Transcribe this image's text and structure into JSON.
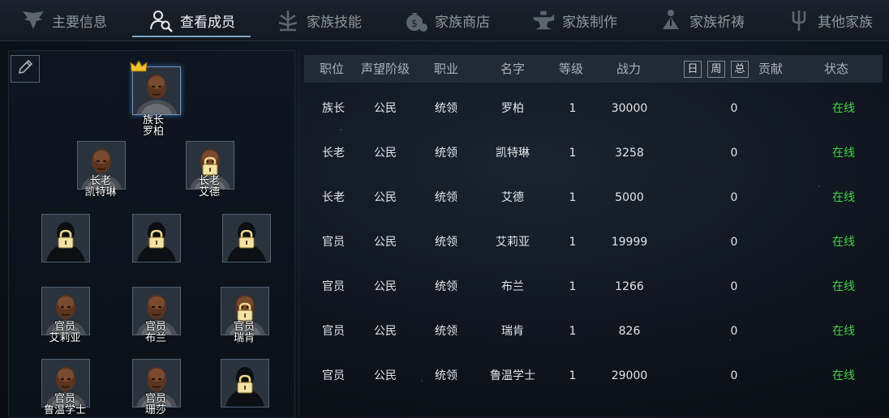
{
  "tabs": [
    {
      "label": "主要信息",
      "icon": "wings-emblem-icon"
    },
    {
      "label": "查看成员",
      "icon": "members-search-icon",
      "active": true
    },
    {
      "label": "家族技能",
      "icon": "skill-tree-icon"
    },
    {
      "label": "家族商店",
      "icon": "money-bag-icon"
    },
    {
      "label": "家族制作",
      "icon": "anvil-icon"
    },
    {
      "label": "家族祈祷",
      "icon": "prayer-icon"
    },
    {
      "label": "其他家族",
      "icon": "trident-icon"
    }
  ],
  "tree": {
    "leader": {
      "title": "族长",
      "name": "罗柏"
    },
    "elders": [
      {
        "title": "长老",
        "name": "凯特琳"
      },
      {
        "title": "长老",
        "name": "艾德"
      }
    ],
    "officers": [
      {
        "title": "官员",
        "name": "艾莉亚"
      },
      {
        "title": "官员",
        "name": "布兰"
      },
      {
        "title": "官员",
        "name": "瑞肯"
      },
      {
        "title": "官员",
        "name": "鲁温学士"
      },
      {
        "title": "官员",
        "name": "珊莎"
      }
    ]
  },
  "table": {
    "headers": {
      "position": "职位",
      "reputation": "声望阶级",
      "class": "职业",
      "name": "名字",
      "level": "等级",
      "power": "战力",
      "day": "日",
      "week": "周",
      "total": "总",
      "contribution": "贡献",
      "status": "状态"
    },
    "rows": [
      {
        "position": "族长",
        "reputation": "公民",
        "class": "统领",
        "name": "罗柏",
        "level": "1",
        "power": "30000",
        "contribution": "0",
        "status": "在线"
      },
      {
        "position": "长老",
        "reputation": "公民",
        "class": "统领",
        "name": "凯特琳",
        "level": "1",
        "power": "3258",
        "contribution": "0",
        "status": "在线"
      },
      {
        "position": "长老",
        "reputation": "公民",
        "class": "统领",
        "name": "艾德",
        "level": "1",
        "power": "5000",
        "contribution": "0",
        "status": "在线"
      },
      {
        "position": "官员",
        "reputation": "公民",
        "class": "统领",
        "name": "艾莉亚",
        "level": "1",
        "power": "19999",
        "contribution": "0",
        "status": "在线"
      },
      {
        "position": "官员",
        "reputation": "公民",
        "class": "统领",
        "name": "布兰",
        "level": "1",
        "power": "1266",
        "contribution": "0",
        "status": "在线"
      },
      {
        "position": "官员",
        "reputation": "公民",
        "class": "统领",
        "name": "瑞肯",
        "level": "1",
        "power": "826",
        "contribution": "0",
        "status": "在线"
      },
      {
        "position": "官员",
        "reputation": "公民",
        "class": "统领",
        "name": "鲁温学士",
        "level": "1",
        "power": "29000",
        "contribution": "0",
        "status": "在线"
      }
    ]
  },
  "colors": {
    "online": "#44d444",
    "accent": "#7aa6c8"
  }
}
